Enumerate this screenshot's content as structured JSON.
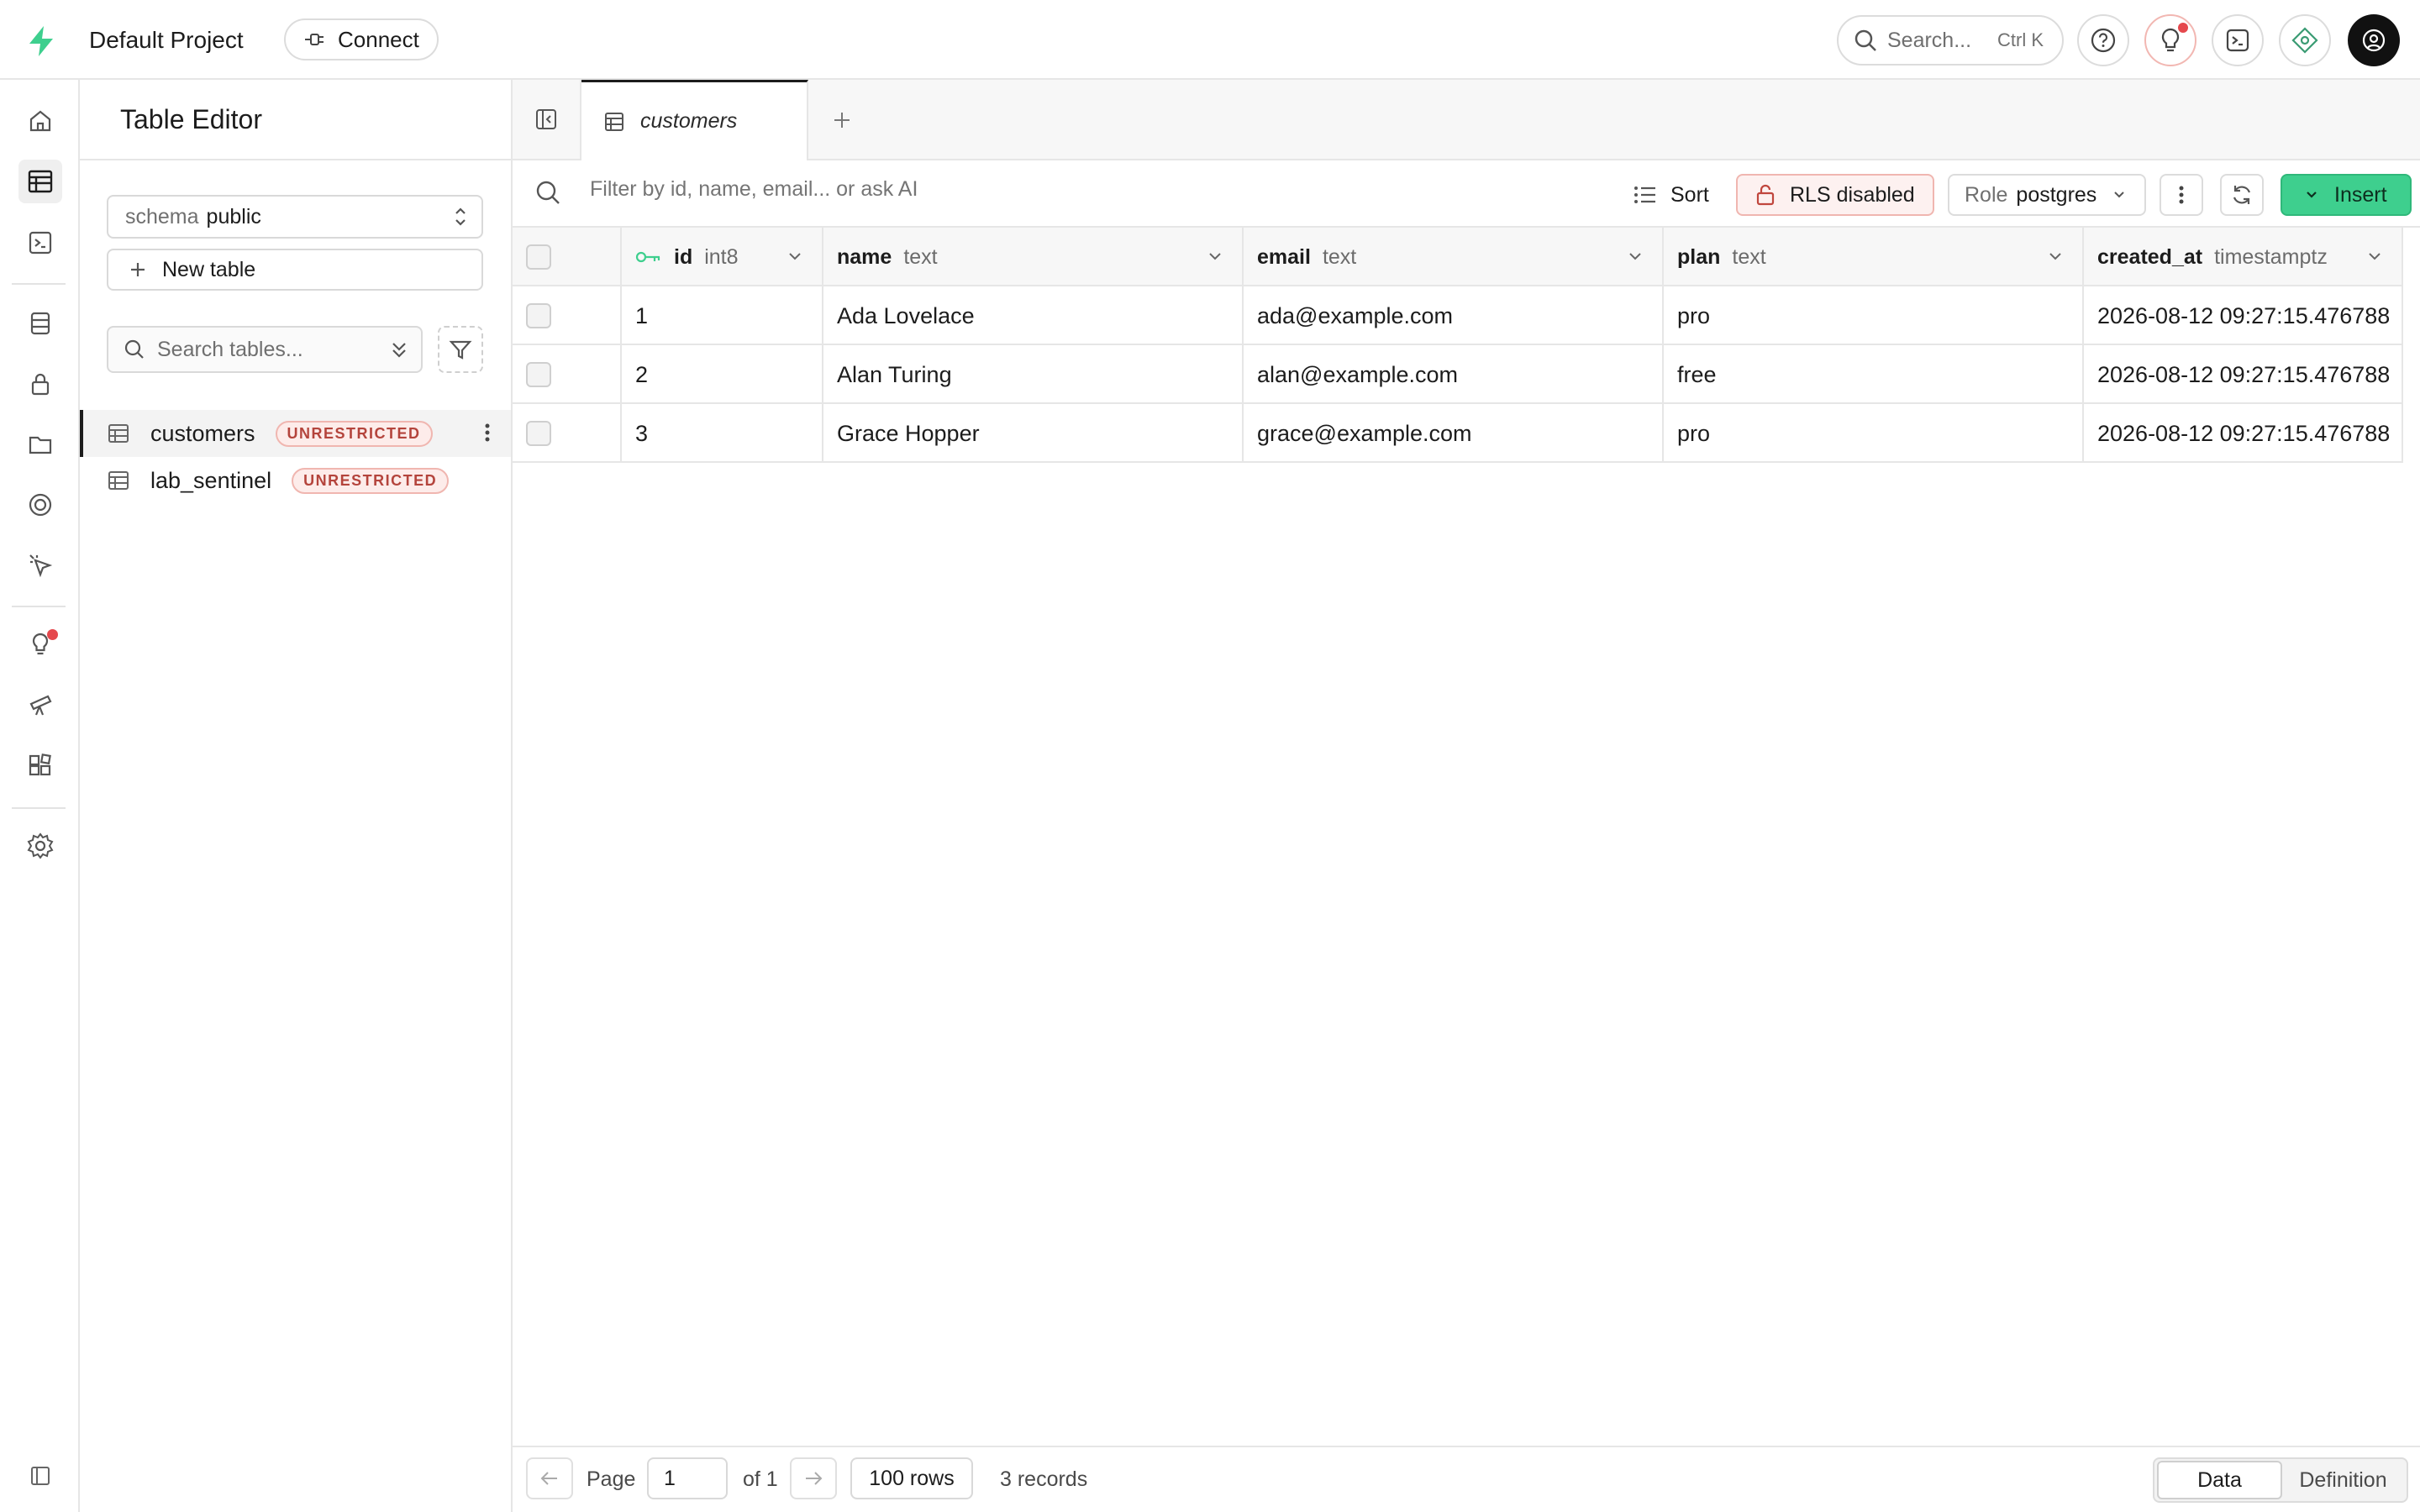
{
  "topbar": {
    "project_name": "Default Project",
    "connect_label": "Connect",
    "search_label": "Search...",
    "search_shortcut": "Ctrl K"
  },
  "sidebar": {
    "title": "Table Editor",
    "schema_prefix": "schema",
    "schema_value": "public",
    "new_table_label": "New table",
    "search_placeholder": "Search tables...",
    "tables": [
      {
        "name": "customers",
        "badge": "UNRESTRICTED",
        "active": true
      },
      {
        "name": "lab_sentinel",
        "badge": "UNRESTRICTED",
        "active": false
      }
    ]
  },
  "main": {
    "tab_label": "customers",
    "filter_placeholder": "Filter by id, name, email... or ask AI",
    "sort_label": "Sort",
    "rls_label": "RLS disabled",
    "role_prefix": "Role",
    "role_value": "postgres",
    "insert_label": "Insert"
  },
  "grid": {
    "columns": [
      {
        "name": "id",
        "type": "int8",
        "primary_key": true
      },
      {
        "name": "name",
        "type": "text"
      },
      {
        "name": "email",
        "type": "text"
      },
      {
        "name": "plan",
        "type": "text"
      },
      {
        "name": "created_at",
        "type": "timestamptz"
      }
    ],
    "rows": [
      [
        "1",
        "Ada Lovelace",
        "ada@example.com",
        "pro",
        "2026-08-12 09:27:15.476788"
      ],
      [
        "2",
        "Alan Turing",
        "alan@example.com",
        "free",
        "2026-08-12 09:27:15.476788"
      ],
      [
        "3",
        "Grace Hopper",
        "grace@example.com",
        "pro",
        "2026-08-12 09:27:15.476788"
      ]
    ]
  },
  "footer": {
    "page_label": "Page",
    "page_value": "1",
    "of_label": "of 1",
    "rows_label": "100 rows",
    "records_label": "3 records",
    "view_data": "Data",
    "view_definition": "Definition"
  },
  "colors": {
    "brand": "#3ecf8e",
    "danger_badge": "#b4443c",
    "notification_dot": "#e5484d"
  }
}
